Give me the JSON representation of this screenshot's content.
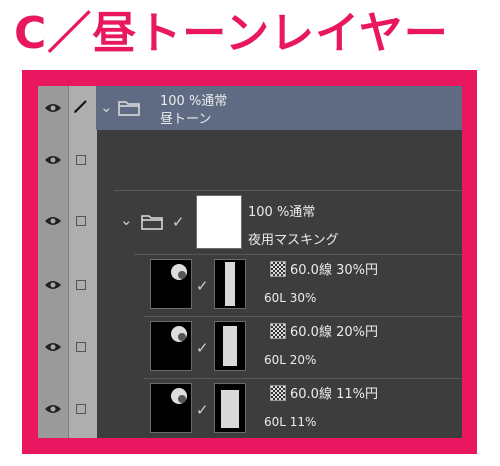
{
  "heading": "C／昼トーンレイヤー",
  "colors": {
    "accent": "#e8175f",
    "panel": "#3d3d3d",
    "selected_row": "#5e6b82"
  },
  "layers": [
    {
      "opacity_blend": "100 %通常",
      "name": "昼トーン"
    },
    {
      "empty": true
    },
    {
      "opacity_blend": "100 %通常",
      "name": "夜用マスキング"
    },
    {
      "tone_label": "60.0線 30%円",
      "name": "60L 30%"
    },
    {
      "tone_label": "60.0線 20%円",
      "name": "60L 20%"
    },
    {
      "tone_label": "60.0線 11%円",
      "name": "60L 11%"
    }
  ],
  "icons": {
    "visibility": "eye-icon",
    "lock": "checkbox-icon",
    "folder": "folder-icon",
    "pen": "pen-icon",
    "expand": "chevron-down-icon"
  }
}
